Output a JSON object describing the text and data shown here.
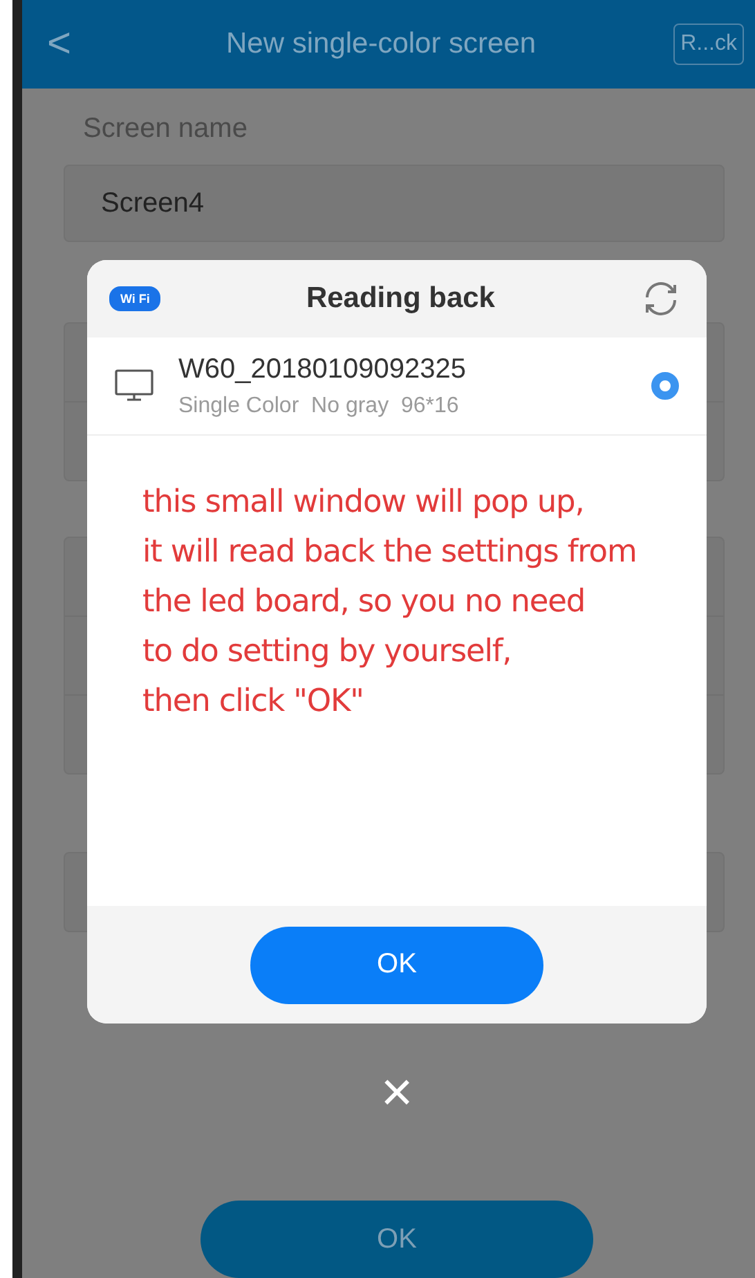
{
  "header": {
    "back": "<",
    "title": "New single-color screen",
    "action": "R...ck"
  },
  "form": {
    "label": "Screen name",
    "value": "Screen4"
  },
  "dialog": {
    "title": "Reading back",
    "badge": "Wi Fi",
    "devices": [
      {
        "name": "W60_20180109092325",
        "details": "Single Color  No gray  96*16",
        "selected": true
      }
    ],
    "annotation": "this small window will pop up,\nit will read back the settings from\nthe led board, so you no need\nto do setting by yourself,\nthen click \"OK\"",
    "ok": "OK",
    "close": "×"
  },
  "footer": {
    "ok": "OK"
  }
}
